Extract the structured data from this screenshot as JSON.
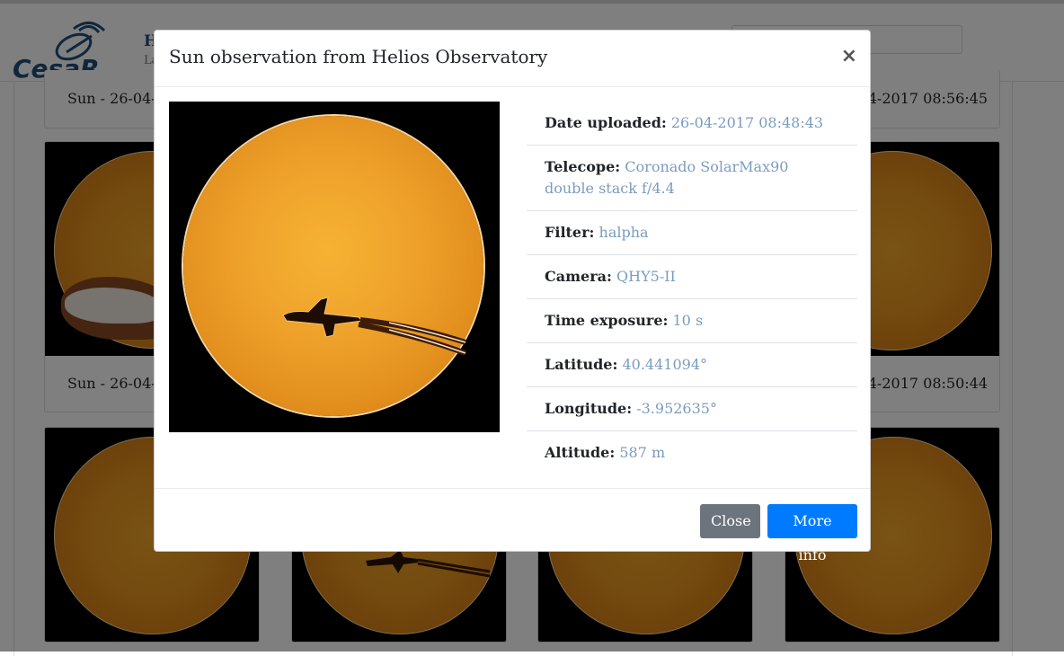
{
  "colors": {
    "backdrop": "rgba(0,0,0,0.5)",
    "primary_button": "#007bff",
    "secondary_button": "#6c757d",
    "value_text": "#7a9cbf",
    "logo_blue": "#1f4e79"
  },
  "header": {
    "logo_text": "CesaR",
    "site_title": "H",
    "site_subtitle": "La"
  },
  "gallery": {
    "captions": [
      "Sun - 26-04-2",
      "04-2017 08:56:45",
      "Sun - 26-04-2",
      "04-2017 08:50:44"
    ]
  },
  "modal": {
    "title": "Sun observation from Helios Observatory",
    "close_icon": "×",
    "image_alt": "sun-with-airplane-transit",
    "details": [
      {
        "label": "Date uploaded:",
        "value": "26-04-2017 08:48:43"
      },
      {
        "label": "Telecope:",
        "value": "Coronado SolarMax90 double stack f/4.4"
      },
      {
        "label": "Filter:",
        "value": "halpha"
      },
      {
        "label": "Camera:",
        "value": "QHY5-II"
      },
      {
        "label": "Time exposure:",
        "value": "10 s"
      },
      {
        "label": "Latitude:",
        "value": "40.441094°"
      },
      {
        "label": "Longitude:",
        "value": "-3.952635°"
      },
      {
        "label": "Altitude:",
        "value": "587 m"
      }
    ],
    "buttons": {
      "close": "Close",
      "more_info": "More info"
    }
  }
}
